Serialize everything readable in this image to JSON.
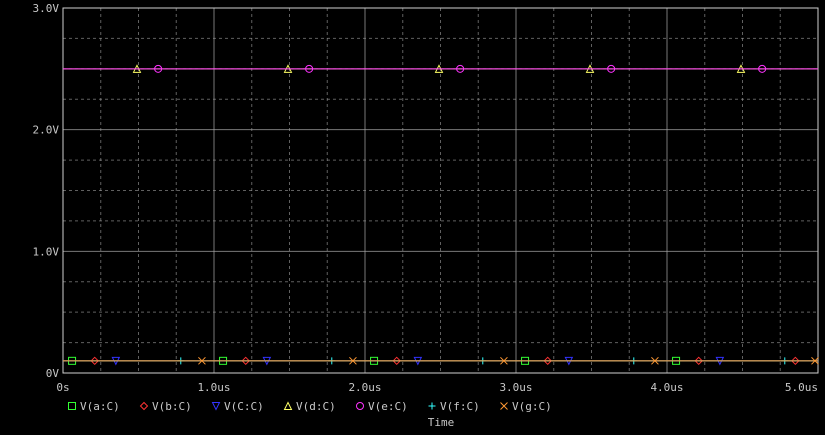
{
  "chart_data": {
    "type": "line",
    "title": "",
    "xlabel": "Time",
    "ylabel": "",
    "xlim": [
      0,
      5.0
    ],
    "ylim": [
      0,
      3.0
    ],
    "x_unit": "us",
    "y_unit": "V",
    "grid": true,
    "legend_position": "bottom",
    "x_ticks": [
      {
        "value": 0,
        "label": "0s"
      },
      {
        "value": 1.0,
        "label": "1.0us"
      },
      {
        "value": 2.0,
        "label": "2.0us"
      },
      {
        "value": 3.0,
        "label": "3.0us"
      },
      {
        "value": 4.0,
        "label": "4.0us"
      },
      {
        "value": 5.0,
        "label": "5.0us"
      }
    ],
    "y_ticks": [
      {
        "value": 0,
        "label": "0V"
      },
      {
        "value": 1.0,
        "label": "1.0V"
      },
      {
        "value": 2.0,
        "label": "2.0V"
      },
      {
        "value": 3.0,
        "label": "3.0V"
      }
    ],
    "series": [
      {
        "name": "V(a:C)",
        "marker": "square",
        "color": "#33ff33",
        "value": 0.1,
        "marker_x": [
          0.06,
          1.06,
          2.06,
          3.06,
          4.06
        ]
      },
      {
        "name": "V(b:C)",
        "marker": "diamond",
        "color": "#ff3333",
        "value": 0.1,
        "marker_x": [
          0.21,
          1.21,
          2.21,
          3.21,
          4.21,
          4.85
        ]
      },
      {
        "name": "V(C:C)",
        "marker": "triangle-down",
        "color": "#3333ff",
        "value": 0.1,
        "marker_x": [
          0.35,
          1.35,
          2.35,
          3.35,
          4.35
        ]
      },
      {
        "name": "V(d:C)",
        "marker": "triangle-up",
        "color": "#ffff66",
        "value": 2.5,
        "marker_x": [
          0.49,
          1.49,
          2.49,
          3.49,
          4.49
        ]
      },
      {
        "name": "V(e:C)",
        "marker": "circle",
        "color": "#ff33ff",
        "value": 2.5,
        "marker_x": [
          0.63,
          1.63,
          2.63,
          3.63,
          4.63
        ]
      },
      {
        "name": "V(f:C)",
        "marker": "plus",
        "color": "#33ffff",
        "value": 0.1,
        "marker_x": [
          0.78,
          1.78,
          2.78,
          3.78,
          4.78
        ]
      },
      {
        "name": "V(g:C)",
        "marker": "cross",
        "color": "#ff9933",
        "value": 0.1,
        "marker_x": [
          0.92,
          1.92,
          2.92,
          3.92,
          4.98
        ]
      }
    ]
  },
  "colors": {
    "background": "#000000",
    "axis_text": "#c8c8c8",
    "grid": "#a0a0a0",
    "frame": "#d0d0d0"
  }
}
